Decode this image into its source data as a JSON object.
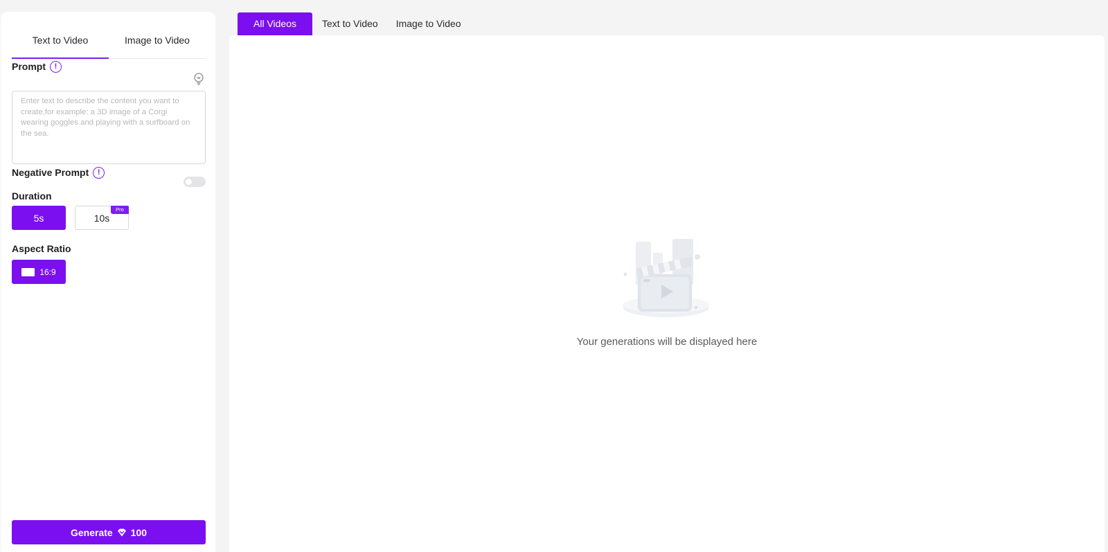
{
  "left_panel": {
    "mode_tabs": [
      {
        "label": "Text to Video",
        "active": true
      },
      {
        "label": "Image to Video",
        "active": false
      }
    ],
    "prompt": {
      "label": "Prompt",
      "placeholder": "Enter text to describe the content you want to create,for example: a 3D image of a Corgi wearing goggles and playing with a surfboard on the sea.",
      "value": ""
    },
    "negative_prompt": {
      "label": "Negative Prompt",
      "enabled": false
    },
    "duration": {
      "label": "Duration",
      "options": [
        {
          "label": "5s",
          "selected": true
        },
        {
          "label": "10s",
          "selected": false,
          "badge": "Pro"
        }
      ]
    },
    "aspect_ratio": {
      "label": "Aspect Ratio",
      "options": [
        {
          "label": "16:9",
          "selected": true
        }
      ]
    },
    "generate": {
      "label": "Generate",
      "cost": "100"
    }
  },
  "main": {
    "filter_tabs": [
      {
        "label": "All Videos",
        "active": true
      },
      {
        "label": "Text to Video",
        "active": false
      },
      {
        "label": "Image to Video",
        "active": false
      }
    ],
    "empty_state": {
      "message": "Your generations will be displayed here"
    }
  },
  "colors": {
    "accent": "#7b0ff0",
    "background": "#f4f4f5",
    "panel": "#ffffff",
    "border": "#d9d9d9"
  },
  "icons": {
    "info": "info-icon",
    "bulb": "lightbulb-icon",
    "gem": "gem-icon",
    "ratio": "aspect-ratio-icon",
    "empty": "video-clapper-illustration"
  }
}
